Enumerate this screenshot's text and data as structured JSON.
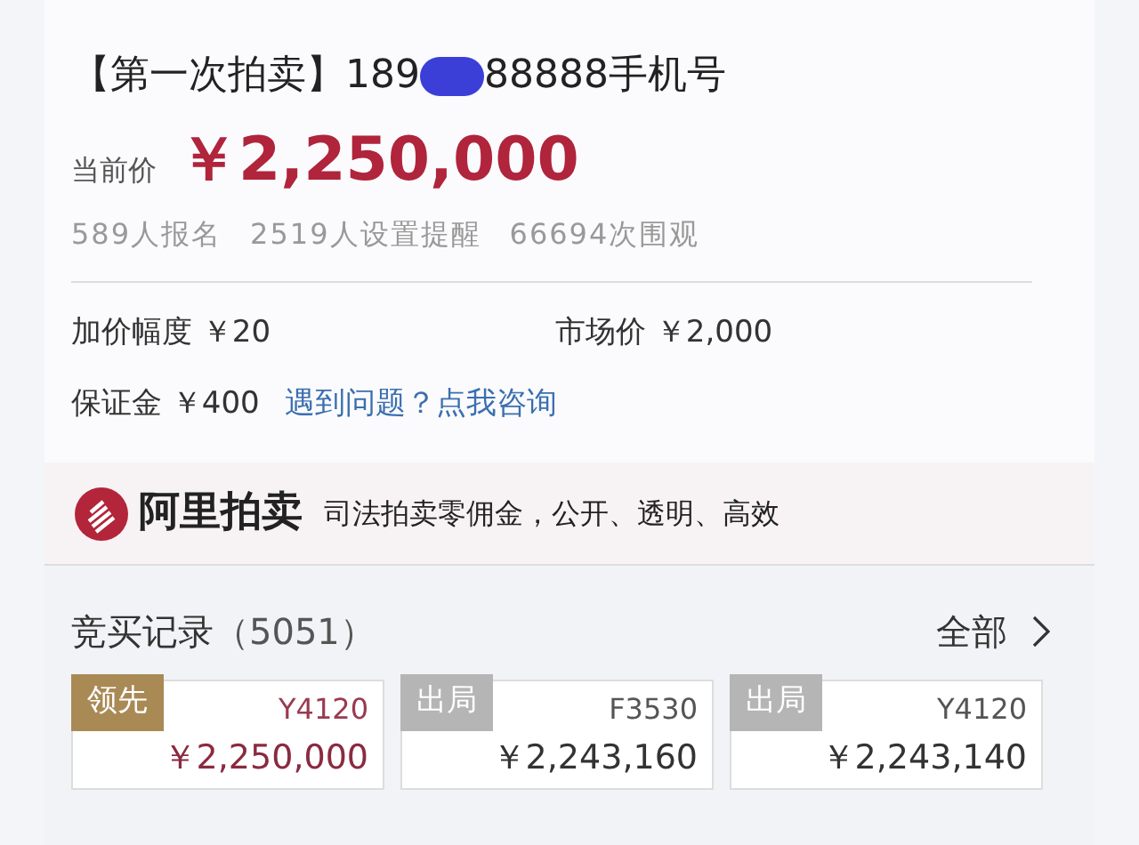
{
  "title": {
    "start": "【第一次拍卖】189",
    "end": "88888手机号",
    "redacted": true
  },
  "price": {
    "label": "当前价",
    "value": "￥2,250,000"
  },
  "stats": [
    "589人报名",
    "2519人设置提醒",
    "66694次围观"
  ],
  "details": [
    {
      "label": "加价幅度",
      "value": "￥20"
    },
    {
      "label": "市场价",
      "value": "￥2,000"
    }
  ],
  "deposit": {
    "label": "保证金",
    "value": "￥400",
    "link": "遇到问题？点我咨询"
  },
  "banner": {
    "brand": "阿里拍卖",
    "slogan": "司法拍卖零佣金，公开、透明、高效"
  },
  "bids": {
    "title": "竞买记录",
    "count": "（5051）",
    "all": "全部",
    "items": [
      {
        "status": "领先",
        "leading": true,
        "bidder": "Y4120",
        "amount": "￥2,250,000"
      },
      {
        "status": "出局",
        "leading": false,
        "bidder": "F3530",
        "amount": "￥2,243,160"
      },
      {
        "status": "出局",
        "leading": false,
        "bidder": "Y4120",
        "amount": "￥2,243,140"
      }
    ]
  }
}
